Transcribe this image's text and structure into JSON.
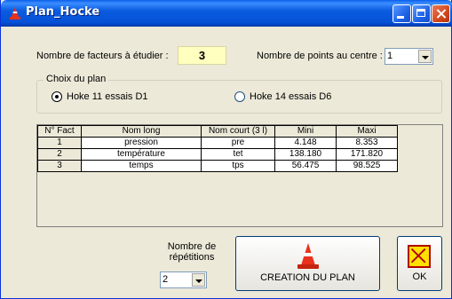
{
  "window": {
    "title": "Plan_Hocke"
  },
  "factors": {
    "label": "Nombre de facteurs à étudier :",
    "value": "3"
  },
  "centre_points": {
    "label": "Nombre de points au centre :",
    "value": "1"
  },
  "plan_choice": {
    "title": "Choix du plan",
    "option1": "Hoke 11 essais D1",
    "option2": "Hoke 14 essais D6",
    "selected": "option1"
  },
  "table": {
    "headers": [
      "N° Fact",
      "Nom long",
      "Nom court (3 l)",
      "Mini",
      "Maxi"
    ],
    "rows": [
      [
        "1",
        "pression",
        "pre",
        "4.148",
        "8.353"
      ],
      [
        "2",
        "température",
        "tet",
        "138.180",
        "171.820"
      ],
      [
        "3",
        "temps",
        "tps",
        "56.475",
        "98.525"
      ]
    ]
  },
  "repetitions": {
    "label_line1": "Nombre de",
    "label_line2": "répétitions",
    "value": "2"
  },
  "buttons": {
    "creation": "CREATION DU PLAN",
    "ok": "OK"
  },
  "icons": {
    "app": "traffic-cone-icon",
    "creation": "traffic-cone-icon",
    "ok": "cancel-x-icon"
  },
  "colors": {
    "accent_title": "#0551d6",
    "factor_box": "#ffffc0",
    "cone": "#e8321c"
  }
}
